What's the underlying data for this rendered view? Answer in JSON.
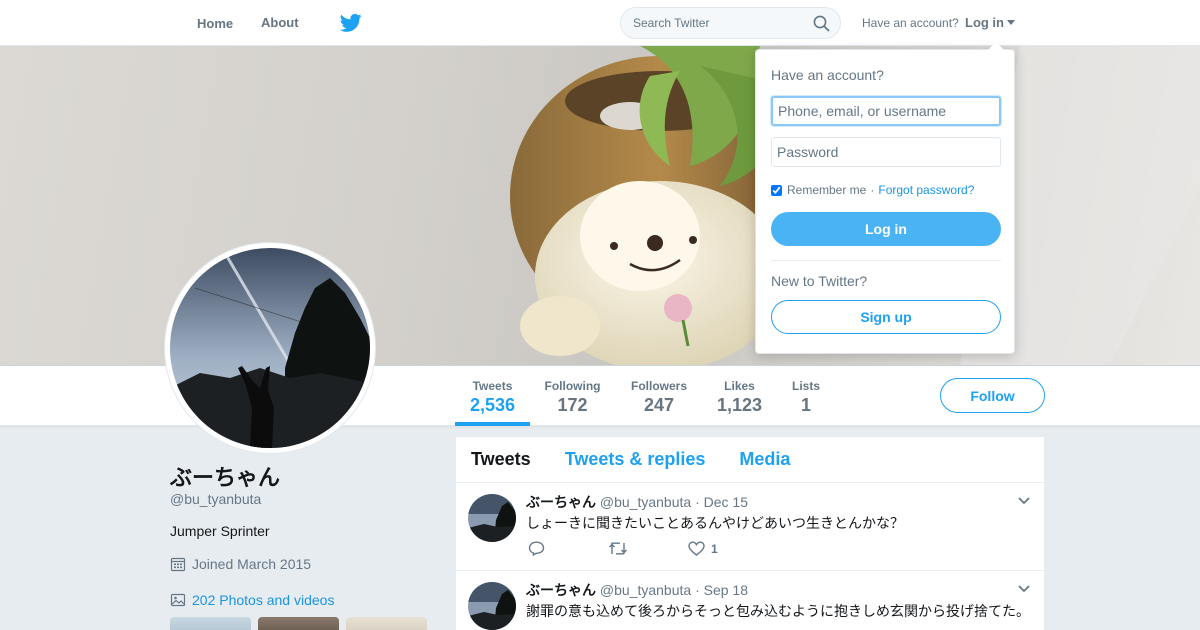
{
  "nav": {
    "home_label": "Home",
    "about_label": "About",
    "search_placeholder": "Search Twitter",
    "have_account": "Have an account?",
    "login_label": "Log in"
  },
  "brand": {
    "accent": "#1da1f2",
    "logo_icon": "twitter-bird-icon"
  },
  "stats": [
    {
      "label": "Tweets",
      "value": "2,536",
      "active": true
    },
    {
      "label": "Following",
      "value": "172"
    },
    {
      "label": "Followers",
      "value": "247"
    },
    {
      "label": "Likes",
      "value": "1,123"
    },
    {
      "label": "Lists",
      "value": "1"
    }
  ],
  "follow_label": "Follow",
  "profile": {
    "name": "ぶーちゃん",
    "handle": "@bu_tyanbuta",
    "bio": "Jumper Sprinter",
    "joined": "Joined March 2015",
    "photos_link": "202 Photos and videos"
  },
  "tabs": [
    "Tweets",
    "Tweets & replies",
    "Media"
  ],
  "tweets": [
    {
      "name": "ぶーちゃん",
      "handle": "@bu_tyanbuta",
      "dot": "·",
      "time": "Dec 15",
      "text": "しょーきに聞きたいことあるんやけどあいつ生きとんかな？",
      "like_count": "1"
    },
    {
      "name": "ぶーちゃん",
      "handle": "@bu_tyanbuta",
      "dot": "·",
      "time": "Sep 18",
      "text": "謝罪の意も込めて後ろからそっと包み込むように抱きしめ玄関から投げ捨てた。",
      "like_count": ""
    }
  ],
  "login_dropdown": {
    "title": "Have an account?",
    "username_placeholder": "Phone, email, or username",
    "password_placeholder": "Password",
    "remember": "Remember me",
    "separator": "·",
    "forgot": "Forgot password?",
    "login_button": "Log in",
    "new_to": "New to Twitter?",
    "signup_button": "Sign up"
  }
}
